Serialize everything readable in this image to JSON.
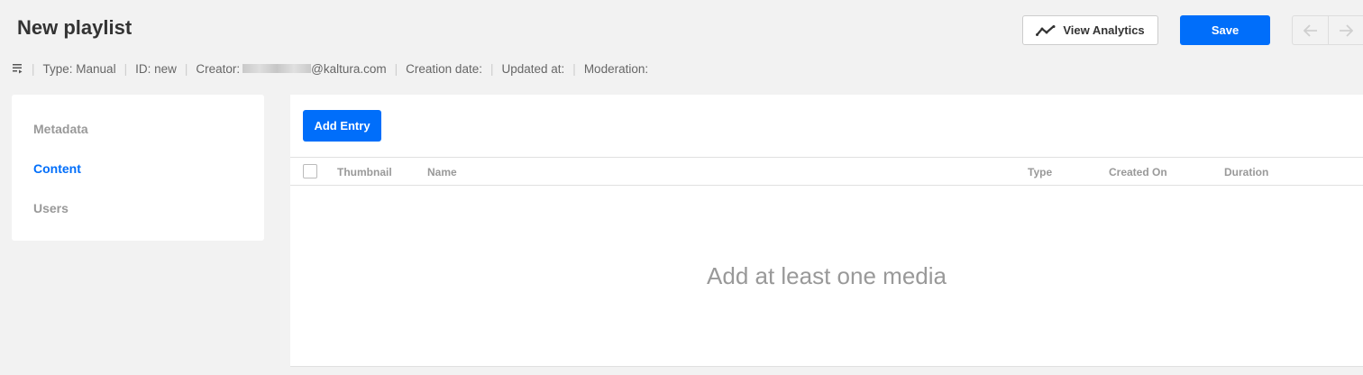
{
  "header": {
    "title": "New playlist",
    "analytics_label": "View Analytics",
    "save_label": "Save"
  },
  "meta": {
    "type": "Type: Manual",
    "id": "ID: new",
    "creator_prefix": "Creator:",
    "creator_domain": "@kaltura.com",
    "creation_date": "Creation date:",
    "updated_at": "Updated at:",
    "moderation": "Moderation:"
  },
  "sidebar": {
    "items": [
      {
        "label": "Metadata"
      },
      {
        "label": "Content"
      },
      {
        "label": "Users"
      }
    ]
  },
  "content": {
    "add_label": "Add Entry",
    "columns": [
      "Thumbnail",
      "Name",
      "Type",
      "Created On",
      "Duration"
    ],
    "empty_message": "Add at least one media"
  },
  "colors": {
    "accent": "#006efa",
    "muted_text": "#999999"
  }
}
